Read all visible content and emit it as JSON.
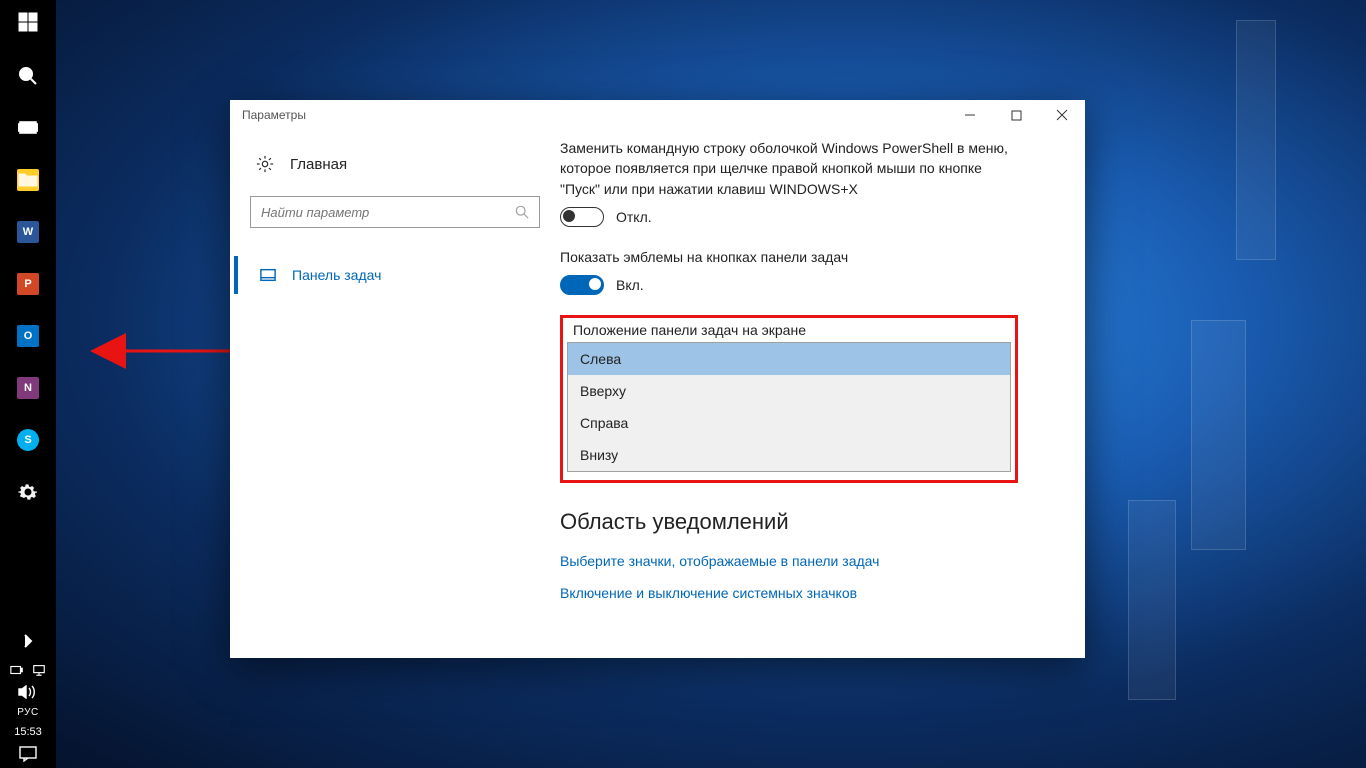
{
  "taskbar": {
    "lang": "РУС",
    "clock": "15:53"
  },
  "window": {
    "title": "Параметры"
  },
  "sidebar": {
    "home": "Главная",
    "search_placeholder": "Найти параметр",
    "nav_taskbar": "Панель задач"
  },
  "settings": {
    "powershell_text": "Заменить командную строку оболочкой Windows PowerShell в меню, которое появляется при щелчке правой кнопкой мыши по кнопке \"Пуск\" или при нажатии клавиш WINDOWS+X",
    "powershell_state": "Откл.",
    "badges_text": "Показать эмблемы на кнопках панели задач",
    "badges_state": "Вкл.",
    "position": {
      "label": "Положение панели задач на экране",
      "options": {
        "left": "Слева",
        "top": "Вверху",
        "right": "Справа",
        "bottom": "Внизу"
      }
    },
    "notif_heading": "Область уведомлений",
    "link_icons": "Выберите значки, отображаемые в панели задач",
    "link_sysicons": "Включение и выключение системных значков"
  }
}
